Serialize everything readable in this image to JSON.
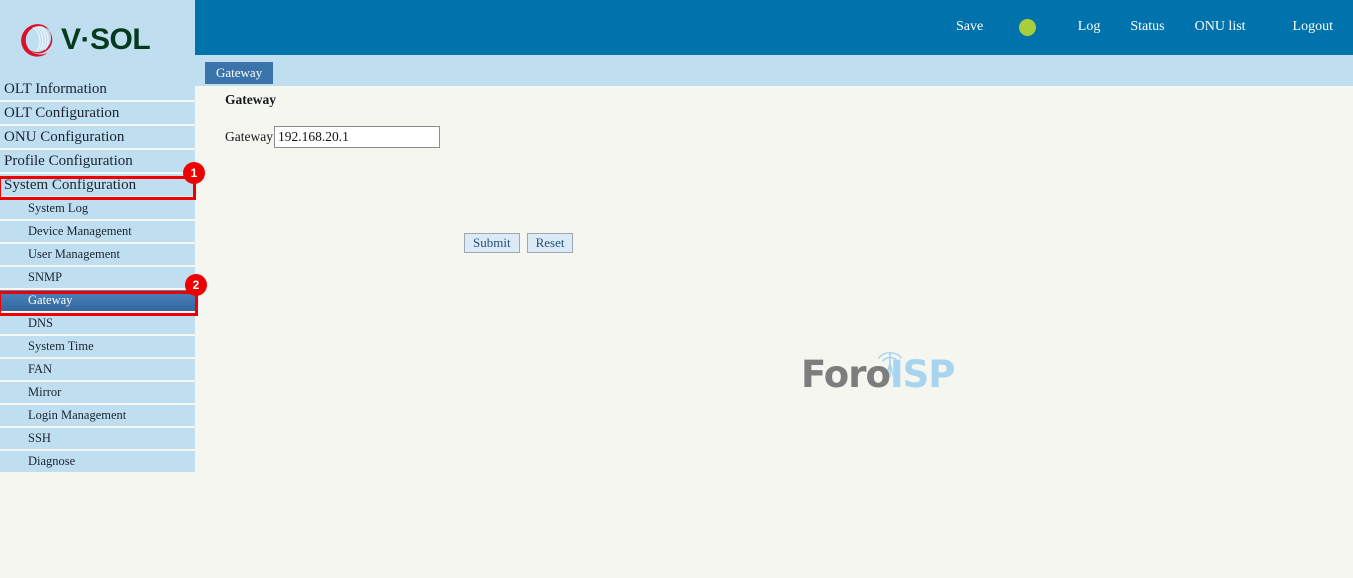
{
  "brand": {
    "logo_text_v": "V",
    "logo_text_dot": "·",
    "logo_text_sol": "SOL",
    "logo_full": "V·SOL",
    "logo_icon": "vsol-swirl-icon",
    "color_red": "#d8102b",
    "color_green": "#063a1e"
  },
  "header": {
    "save_label": "Save",
    "status_indicator": "green-status-dot",
    "status_color": "#a8ce39",
    "links": [
      {
        "label": "Log"
      },
      {
        "label": "Status"
      },
      {
        "label": "ONU list"
      },
      {
        "label": "Logout"
      }
    ],
    "background_color": "#0073ac"
  },
  "sidebar": {
    "items": [
      {
        "label": "OLT Information",
        "level": "main",
        "selected": false
      },
      {
        "label": "OLT Configuration",
        "level": "main",
        "selected": false
      },
      {
        "label": "ONU Configuration",
        "level": "main",
        "selected": false
      },
      {
        "label": "Profile Configuration",
        "level": "main",
        "selected": false
      },
      {
        "label": "System Configuration",
        "level": "main",
        "selected": false
      },
      {
        "label": "System Log",
        "level": "sub",
        "selected": false
      },
      {
        "label": "Device Management",
        "level": "sub",
        "selected": false
      },
      {
        "label": "User Management",
        "level": "sub",
        "selected": false
      },
      {
        "label": "SNMP",
        "level": "sub",
        "selected": false
      },
      {
        "label": "Gateway",
        "level": "sub",
        "selected": true
      },
      {
        "label": "DNS",
        "level": "sub",
        "selected": false
      },
      {
        "label": "System Time",
        "level": "sub",
        "selected": false
      },
      {
        "label": "FAN",
        "level": "sub",
        "selected": false
      },
      {
        "label": "Mirror",
        "level": "sub",
        "selected": false
      },
      {
        "label": "Login Management",
        "level": "sub",
        "selected": false
      },
      {
        "label": "SSH",
        "level": "sub",
        "selected": false
      },
      {
        "label": "Diagnose",
        "level": "sub",
        "selected": false
      }
    ]
  },
  "tabs": [
    {
      "label": "Gateway",
      "active": true
    }
  ],
  "main": {
    "section_title": "Gateway",
    "form": {
      "field_label": "Gateway",
      "field_value": "192.168.20.1",
      "field_placeholder": ""
    },
    "buttons": {
      "submit_label": "Submit",
      "reset_label": "Reset"
    }
  },
  "watermark": {
    "text_gray": "Foro",
    "text_blue": "ISP",
    "full": "ForoISP",
    "icon": "antenna-tower-icon",
    "color_gray": "#7d7d7d",
    "color_blue": "#a7d4ee"
  },
  "annotations": [
    {
      "badge": "1",
      "target": "System Configuration"
    },
    {
      "badge": "2",
      "target": "Gateway"
    }
  ]
}
